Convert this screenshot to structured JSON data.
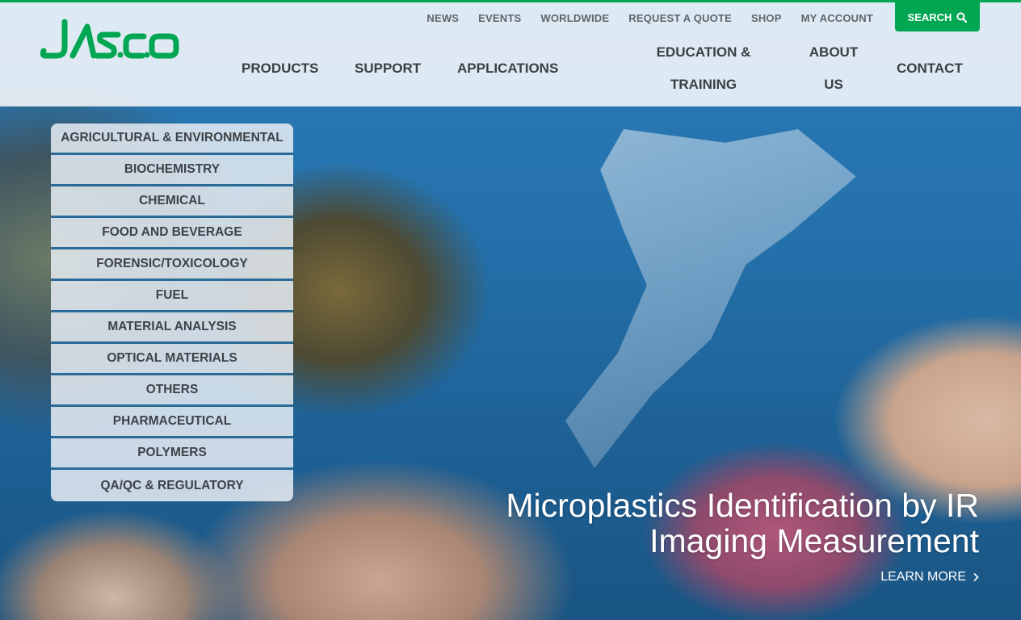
{
  "brand": {
    "logo_text": "JASCO",
    "accent": "#00a651"
  },
  "utility_nav": [
    "NEWS",
    "EVENTS",
    "WORLDWIDE",
    "REQUEST A QUOTE",
    "SHOP",
    "MY ACCOUNT"
  ],
  "search": {
    "label": "SEARCH",
    "icon": "search-icon"
  },
  "main_nav": {
    "products": "PRODUCTS",
    "support": "SUPPORT",
    "applications": "APPLICATIONS",
    "education_line1": "EDUCATION &",
    "education_line2": "TRAINING",
    "about_line1": "ABOUT",
    "about_line2": "US",
    "contact": "CONTACT"
  },
  "applications_menu": [
    "AGRICULTURAL & ENVIRONMENTAL",
    "BIOCHEMISTRY",
    "CHEMICAL",
    "FOOD AND BEVERAGE",
    "FORENSIC/TOXICOLOGY",
    "FUEL",
    "MATERIAL ANALYSIS",
    "OPTICAL MATERIALS",
    "OTHERS",
    "PHARMACEUTICAL",
    "POLYMERS",
    "QA/QC & REGULATORY"
  ],
  "hero": {
    "title_line1": "Microplastics Identification by IR",
    "title_line2": "Imaging Measurement",
    "cta": "LEARN MORE",
    "cta_icon": "chevron-right-icon"
  }
}
